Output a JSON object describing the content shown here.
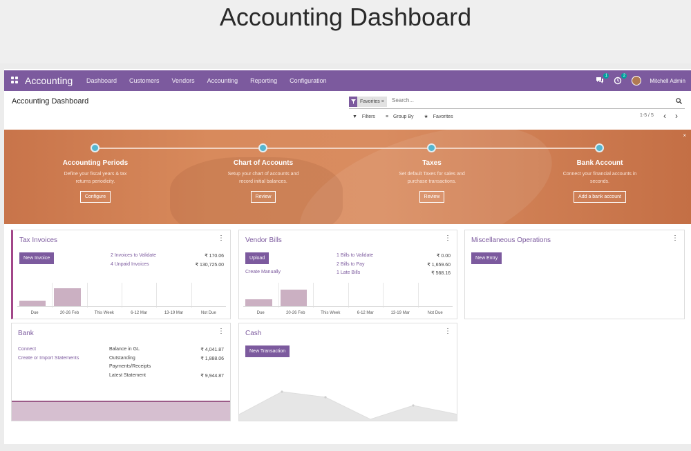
{
  "page_heading": "Accounting Dashboard",
  "navbar": {
    "brand": "Accounting",
    "menu": [
      "Dashboard",
      "Customers",
      "Vendors",
      "Accounting",
      "Reporting",
      "Configuration"
    ],
    "messages_badge": "1",
    "activities_badge": "2",
    "user": "Mitchell Admin"
  },
  "control_panel": {
    "title": "Accounting Dashboard",
    "facet_label": "Favorites",
    "facet_remove": "×",
    "search_placeholder": "Search...",
    "filters": "Filters",
    "group_by": "Group By",
    "favorites": "Favorites",
    "pager": "1-5 / 5"
  },
  "onboarding": {
    "close": "×",
    "steps": [
      {
        "title": "Accounting Periods",
        "desc1": "Define your fiscal years & tax",
        "desc2": "returns periodicity.",
        "button": "Configure"
      },
      {
        "title": "Chart of Accounts",
        "desc1": "Setup your chart of accounts and",
        "desc2": "record initial balances.",
        "button": "Review"
      },
      {
        "title": "Taxes",
        "desc1": "Set default Taxes for sales and",
        "desc2": "purchase transactions.",
        "button": "Review"
      },
      {
        "title": "Bank Account",
        "desc1": "Connect your financial accounts in",
        "desc2": "seconds.",
        "button": "Add a bank account"
      }
    ]
  },
  "cards": {
    "tax_invoices": {
      "title": "Tax Invoices",
      "button": "New Invoice",
      "link1": "2 Invoices to Validate",
      "amount1": "₹ 170.06",
      "link2": "4 Unpaid Invoices",
      "amount2": "₹ 130,725.00",
      "x_labels": [
        "Due",
        "20-26 Feb",
        "This Week",
        "6-12 Mar",
        "13-19 Mar",
        "Not Due"
      ],
      "bar_values": [
        0.25,
        0.8,
        0,
        0,
        0,
        0
      ]
    },
    "vendor_bills": {
      "title": "Vendor Bills",
      "button": "Upload",
      "create_manually": "Create Manually",
      "link1": "1 Bills to Validate",
      "amount1": "₹ 0.00",
      "link2": "2 Bills to Pay",
      "amount2": "₹ 1,659.60",
      "link3": "1 Late Bills",
      "amount3": "₹ 568.16",
      "x_labels": [
        "Due",
        "20-26 Feb",
        "This Week",
        "6-12 Mar",
        "13-19 Mar",
        "Not Due"
      ],
      "bar_values": [
        0.3,
        0.75,
        0,
        0,
        0,
        0
      ]
    },
    "misc": {
      "title": "Miscellaneous Operations",
      "button": "New Entry"
    },
    "bank": {
      "title": "Bank",
      "connect": "Connect",
      "import": "Create or Import Statements",
      "label1": "Balance in GL",
      "amount1": "₹ 4,041.87",
      "label2": "Outstanding",
      "amount2": "₹ 1,888.06",
      "label3": "Payments/Receipts",
      "label4": "Latest Statement",
      "amount4": "₹ 9,944.87"
    },
    "cash": {
      "title": "Cash",
      "button": "New Transaction"
    }
  },
  "colors": {
    "brand": "#7c5a9e",
    "banner": "#c8744a",
    "bar": "#cbb0c2",
    "fav": "#a24689"
  }
}
